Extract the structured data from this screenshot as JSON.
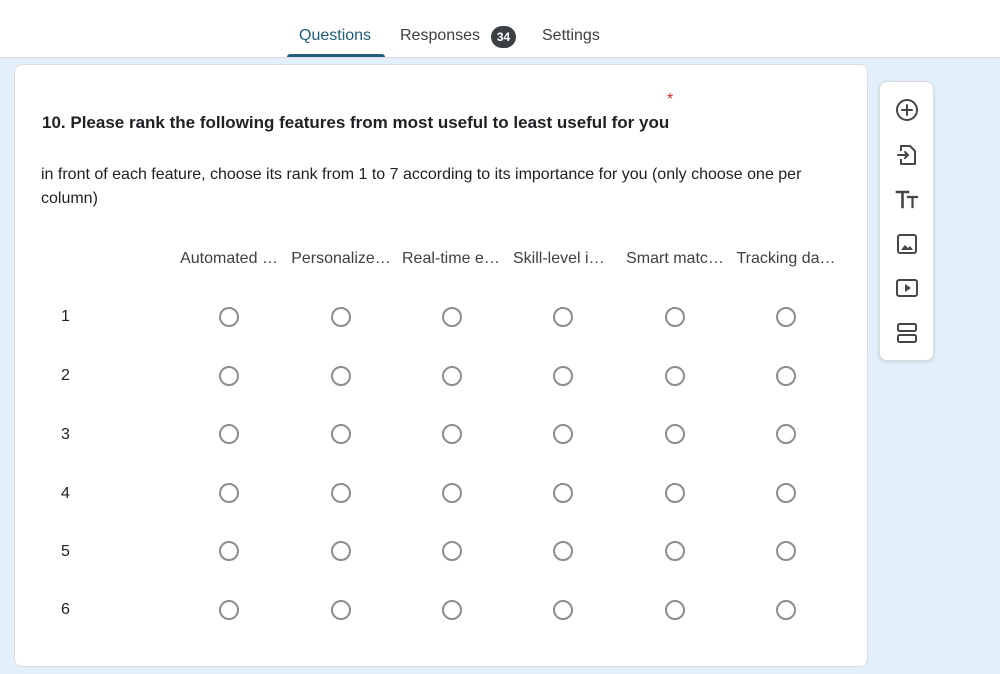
{
  "tabs": {
    "questions": "Questions",
    "responses": "Responses",
    "responses_count": "34",
    "settings": "Settings"
  },
  "question": {
    "title": "10. Please rank the following features from most useful to least useful for you",
    "required_marker": "*",
    "description": "in front of each feature, choose its rank from 1 to 7 according to its importance for you (only choose one per column)",
    "columns": [
      "Automated …",
      "Personalize…",
      "Real-time ex…",
      "Skill-level in…",
      "Smart matc…",
      "Tracking da…"
    ],
    "rows": [
      "1",
      "2",
      "3",
      "4",
      "5",
      "6"
    ]
  },
  "toolbar": {
    "add_question": "add-circle-icon",
    "import_questions": "import-icon",
    "add_title": "title-text-icon",
    "add_image": "image-icon",
    "add_video": "video-icon",
    "add_section": "section-icon"
  },
  "colors": {
    "accent": "#1f5f7a",
    "background": "#e3f0fb",
    "required": "#d93025"
  }
}
